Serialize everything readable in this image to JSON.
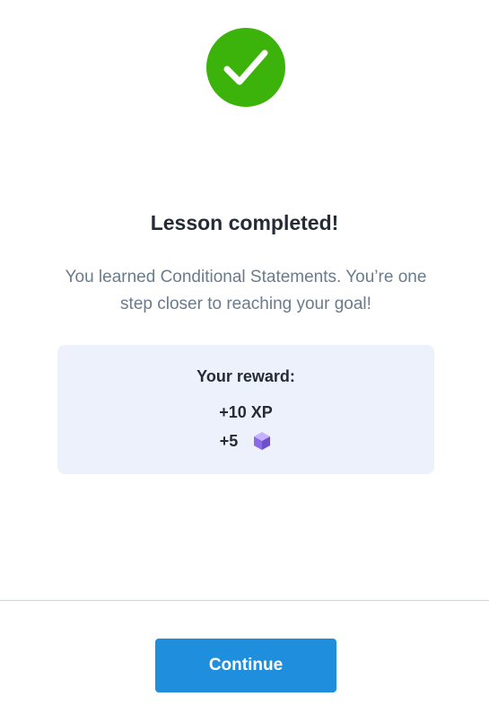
{
  "status": {
    "icon": "check-icon",
    "color": "#3cb30a"
  },
  "lesson": {
    "title": "Lesson completed!",
    "message": "You learned Conditional Statements. You’re one step closer to reaching your goal!"
  },
  "reward": {
    "title": "Your reward:",
    "xp": "+10 XP",
    "gems": "+5",
    "gem_icon": "gem-cube-icon"
  },
  "actions": {
    "continue_label": "Continue",
    "accent_color": "#1f8fdd"
  }
}
